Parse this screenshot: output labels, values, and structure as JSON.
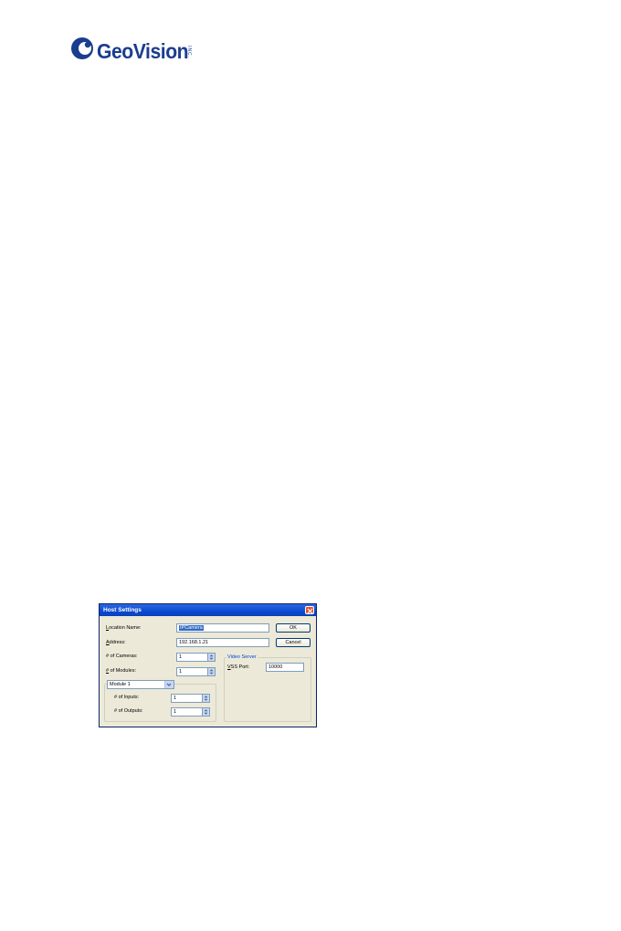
{
  "logo": {
    "brand": "GeoVision",
    "suffix": "INC.",
    "brand_color": "#1a3d8f"
  },
  "dialog": {
    "title": "Host Settings",
    "location_name": {
      "label_first": "L",
      "label_rest": "ocation Name:",
      "value": "IPCamera"
    },
    "address": {
      "label_first": "A",
      "label_rest": "ddress:",
      "value": "192.168.1.21"
    },
    "cameras": {
      "label": "# of Cameras:",
      "value": "1"
    },
    "modules": {
      "label_first": "#",
      "label_rest": " of Modules:",
      "value": "1"
    },
    "module_select": {
      "value": "Module 1"
    },
    "inputs": {
      "label": "# of Inputs:",
      "value": "1"
    },
    "outputs": {
      "label": "# of Outputs:",
      "value": "1"
    },
    "ok_label": "OK",
    "cancel_label": "Cancel",
    "video_server": {
      "title": "Video Server",
      "port_label_first": "V",
      "port_label_rest": "SS Port:",
      "port_value": "10000"
    },
    "colors": {
      "titlebar": "#0a4ad2",
      "close": "#e2542f",
      "face": "#ece9d8",
      "group_title": "#0046d5"
    }
  }
}
